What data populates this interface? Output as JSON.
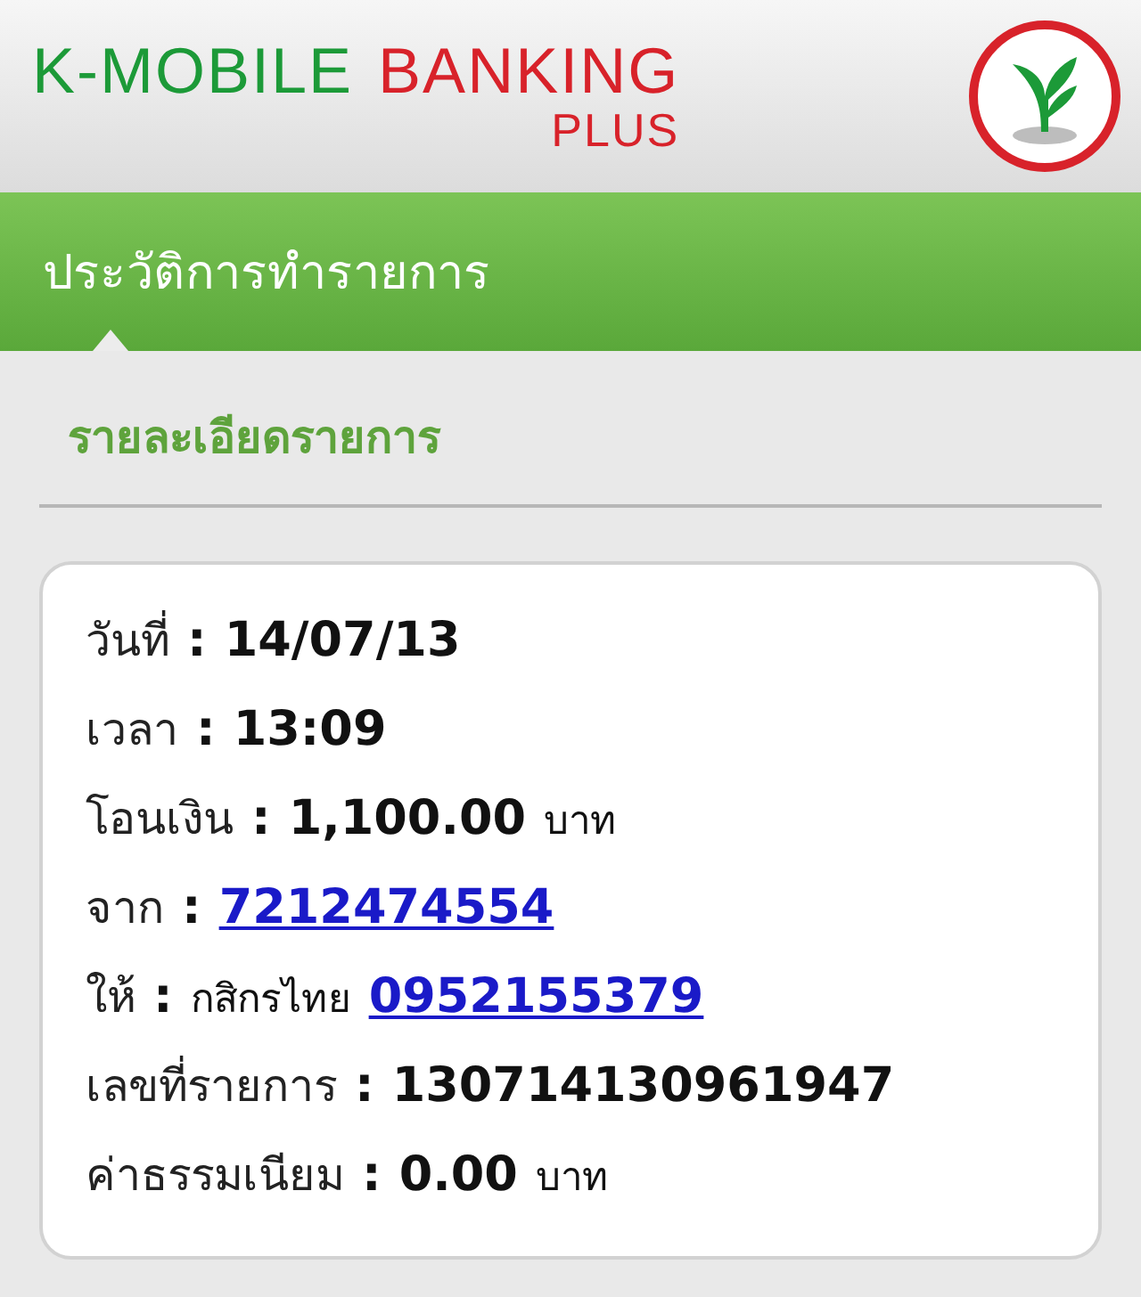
{
  "header": {
    "logo": {
      "brand": "K-MOBILE",
      "product": "BANKING",
      "edition": "PLUS"
    }
  },
  "nav_bar": {
    "title": "ประวัติการทำรายการ"
  },
  "section": {
    "title": "รายละเอียดรายการ"
  },
  "details": [
    {
      "label": "วันที่",
      "separator": ":",
      "parts": [
        {
          "kind": "value",
          "text": "14/07/13"
        }
      ]
    },
    {
      "label": "เวลา",
      "separator": ":",
      "parts": [
        {
          "kind": "value",
          "text": "13:09"
        }
      ]
    },
    {
      "label": "โอนเงิน",
      "separator": ":",
      "parts": [
        {
          "kind": "value",
          "text": "1,100.00"
        },
        {
          "kind": "unit",
          "text": "บาท"
        }
      ]
    },
    {
      "label": "จาก",
      "separator": ":",
      "parts": [
        {
          "kind": "link",
          "text": "7212474554"
        }
      ]
    },
    {
      "label": "ให้",
      "separator": ":",
      "parts": [
        {
          "kind": "unit",
          "text": "กสิกรไทย"
        },
        {
          "kind": "link",
          "text": "0952155379"
        }
      ]
    },
    {
      "label": "เลขที่รายการ",
      "separator": ":",
      "parts": [
        {
          "kind": "value",
          "text": "130714130961947"
        }
      ]
    },
    {
      "label": "ค่าธรรมเนียม",
      "separator": ":",
      "parts": [
        {
          "kind": "value",
          "text": "0.00"
        },
        {
          "kind": "unit",
          "text": "บาท"
        }
      ]
    }
  ]
}
